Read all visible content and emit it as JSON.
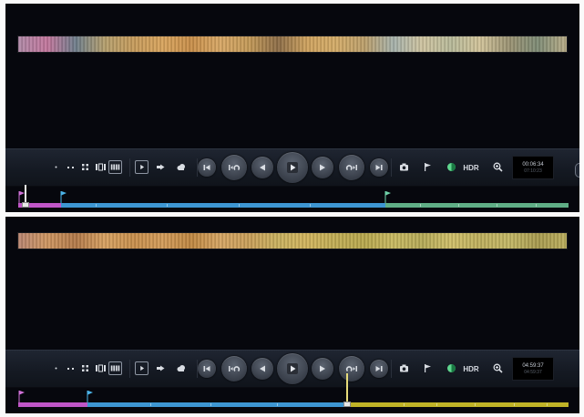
{
  "colors": {
    "background": "#06070d",
    "control_bar": "#181d26",
    "segment_magenta": "#c056c8",
    "segment_blue": "#3d96d2",
    "segment_green": "#5fae86",
    "segment_olive": "#c0b327",
    "marker_blue": "#4bb3e8",
    "marker_magenta": "#d070d8",
    "marker_green": "#6fd1a8"
  },
  "panels": [
    {
      "name": "top",
      "filmstrip_colors": [
        "#b08aa8",
        "#c3779d",
        "#6f7f8c",
        "#b6a06e",
        "#c79c5c",
        "#d9a55e",
        "#c98f4a",
        "#d8a866",
        "#c49a58",
        "#8e6e48",
        "#cfa35f",
        "#d4ac68",
        "#bca06c",
        "#a6b2ac",
        "#cfc4a0",
        "#b8ba9a",
        "#d2c49a",
        "#9c9474",
        "#7f8c76",
        "#b9ad88"
      ],
      "timecode_main": "00:06:34",
      "timecode_sub": "07:10:23",
      "hdr_label": "HDR",
      "timeline": {
        "segments": [
          {
            "color": "#c056c8",
            "fraction": 0.077
          },
          {
            "color": "#3d96d2",
            "fraction": 0.59
          },
          {
            "color": "#5fae86",
            "fraction": 0.333
          }
        ],
        "markers": [
          {
            "color": "#d070d8",
            "pos": 0.0
          },
          {
            "color": "#4bb3e8",
            "pos": 0.077
          },
          {
            "color": "#6fd1a8",
            "pos": 0.667
          }
        ],
        "playhead_pos": 0.012,
        "ticks": [
          0.14,
          0.27,
          0.4,
          0.53,
          0.73,
          0.8,
          0.87,
          0.94
        ]
      }
    },
    {
      "name": "bottom",
      "filmstrip_colors": [
        "#b98672",
        "#cf9762",
        "#b37a4a",
        "#d8a262",
        "#c9904d",
        "#d39c5a",
        "#c08842",
        "#d6a664",
        "#caa05a",
        "#c9b260",
        "#d2b55e",
        "#c2ae55",
        "#b8a84e",
        "#c9ba62",
        "#b6ab58",
        "#d0c06a",
        "#bfb15e",
        "#c4b866",
        "#a99c50",
        "#bcaf5e"
      ],
      "timecode_main": "04:59:37",
      "timecode_sub": "04:59:37",
      "hdr_label": "HDR",
      "timeline": {
        "segments": [
          {
            "color": "#c056c8",
            "fraction": 0.126
          },
          {
            "color": "#3d96d2",
            "fraction": 0.47
          },
          {
            "color": "#c0b327",
            "fraction": 0.404
          }
        ],
        "markers": [
          {
            "color": "#d070d8",
            "pos": 0.0
          },
          {
            "color": "#4bb3e8",
            "pos": 0.126
          }
        ],
        "playhead_pos": 0.596,
        "ticks": [
          0.24,
          0.35,
          0.47,
          0.7,
          0.76,
          0.83,
          0.9,
          0.96
        ]
      }
    }
  ],
  "toolbar_icons": [
    "dot-icon",
    "double-dot-icon",
    "grid-4-icon",
    "filmstrip-3-icon",
    "filmstrip-grid-icon",
    "play-mode-icon",
    "step-forward-icon",
    "cloud-icon",
    "skip-start-icon",
    "loop-back-icon",
    "prev-frame-icon",
    "play-icon",
    "next-frame-icon",
    "loop-forward-icon",
    "skip-end-icon",
    "camera-icon",
    "flag-icon",
    "color-toggle-icon",
    "zoom-icon"
  ]
}
